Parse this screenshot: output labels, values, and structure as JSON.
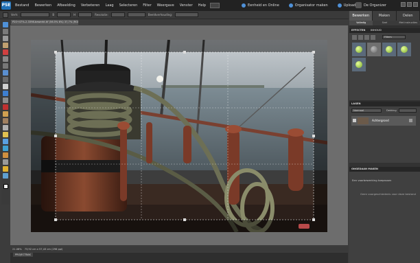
{
  "menubar": {
    "logo_label": "PSE",
    "items": [
      "Bestand",
      "Bewerken",
      "Afbeelding",
      "Verbeteren",
      "Laag",
      "Selecteren",
      "Filter",
      "Weergave",
      "Venster",
      "Help"
    ],
    "right_items": [
      "Eenheid en Online",
      "Organisator maken",
      "Uploaden"
    ],
    "organizer_label": "De Organizer"
  },
  "optionsbar": {
    "labels": [
      "Verh:",
      "Geen beperking",
      "B",
      "H",
      "Resolutie:",
      "pixels/inch",
      "Beeldverhouding:",
      "Raster weergeven"
    ]
  },
  "document": {
    "tab_title": "P20+47%-2-3398-bewerkt.tif (56.5% 6%) 37,7% (RGB/8*)",
    "status": "21.06%",
    "status_dims": "73,92 cm x 57,43 cm (298 ppi)",
    "project_bin_label": "PROJECTBAK"
  },
  "panel": {
    "tabs": [
      "Bewerken",
      "Maken",
      "Delen"
    ],
    "subtabs": [
      "Volledig",
      "Snel",
      "Met instructies"
    ],
    "effects_header": "EFFECTEN",
    "effects_tab": "INHOUD",
    "effects_filter": "Filters",
    "layers_header": "LAGEN",
    "layers_dropdown": "Normaal",
    "layers_opacity_label": "Dekking",
    "layer_name": "Achtergrond",
    "undo_header": "ONGEDAAN MAKEN",
    "undo_line1": "Een voorbewerking toepassen",
    "undo_line2": "Geen voorgeschiedenis voor deze bestand"
  },
  "colors": {
    "accent": "#4f91d8",
    "panel_bg": "#404040",
    "canvas_bg": "#6d6d6d"
  },
  "icons": [
    "home-icon",
    "move-icon",
    "zoom-icon",
    "hand-icon",
    "eyedropper-icon",
    "marquee-icon",
    "lasso-icon",
    "magic-wand-icon",
    "quick-selection-icon",
    "crop-icon",
    "recompose-icon",
    "type-icon",
    "red-eye-icon",
    "spot-healing-icon",
    "clone-stamp-icon",
    "eraser-icon",
    "brush-icon",
    "paint-bucket-icon",
    "gradient-icon",
    "shape-icon",
    "blur-icon",
    "sponge-icon",
    "smart-brush-icon"
  ]
}
